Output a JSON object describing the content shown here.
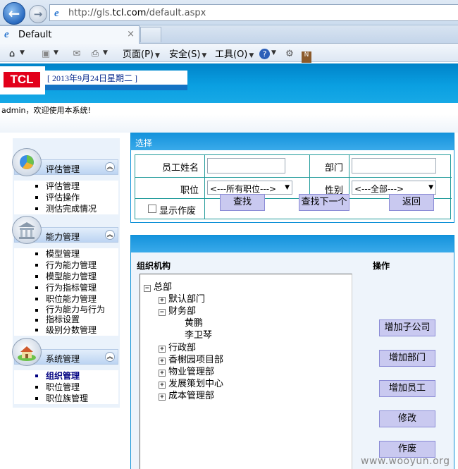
{
  "browser": {
    "url_prefix": "http://gls.",
    "url_domain": "tcl.com",
    "url_suffix": "/default.aspx",
    "tab_title": "Default",
    "tab_close": "×",
    "menu": {
      "page": "页面(P)",
      "safety": "安全(S)",
      "tools": "工具(O)"
    }
  },
  "header": {
    "logo_text": "TCL",
    "date_text": "[ 2013年9月24日星期二 ]",
    "welcome_text": "admin，欢迎使用本系统!"
  },
  "sidebar": {
    "groups": [
      {
        "title": "评估管理",
        "items": [
          "评估管理",
          "评估操作",
          "测估完成情况"
        ]
      },
      {
        "title": "能力管理",
        "items": [
          "模型管理",
          "行为能力管理",
          "模型能力管理",
          "行为指标管理",
          "职位能力管理",
          "行为能力与行为",
          "指标设置",
          "级别分数管理"
        ]
      },
      {
        "title": "系统管理",
        "items": [
          "组织管理",
          "职位管理",
          "职位族管理"
        ]
      }
    ],
    "active_item": "组织管理"
  },
  "search": {
    "title": "选择",
    "employee_name_label": "员工姓名",
    "employee_name_value": "",
    "department_label": "部门",
    "department_value": "",
    "position_label": "职位",
    "position_selected": "<---所有职位--->",
    "gender_label": "性别",
    "gender_selected": "<---全部--->",
    "show_abolished_label": "显示作废",
    "find_button": "查找",
    "find_next_button": "查找下一个",
    "back_button": "返回"
  },
  "org": {
    "org_label": "组织机构",
    "ops_label": "操作",
    "tree": [
      {
        "label": "总部",
        "toggle": "⊟"
      },
      {
        "label": "默认部门",
        "toggle": "⊞"
      },
      {
        "label": "财务部",
        "toggle": "⊟"
      },
      {
        "label": "黄鹏",
        "toggle": ""
      },
      {
        "label": "李卫琴",
        "toggle": ""
      },
      {
        "label": "行政部",
        "toggle": "⊞"
      },
      {
        "label": "香榭园项目部",
        "toggle": "⊞"
      },
      {
        "label": "物业管理部",
        "toggle": "⊞"
      },
      {
        "label": "发展策划中心",
        "toggle": "⊞"
      },
      {
        "label": "成本管理部",
        "toggle": "⊞"
      }
    ],
    "buttons": [
      "增加子公司",
      "增加部门",
      "增加员工",
      "修改",
      "作废"
    ]
  },
  "watermark": "www.wooyun.org"
}
